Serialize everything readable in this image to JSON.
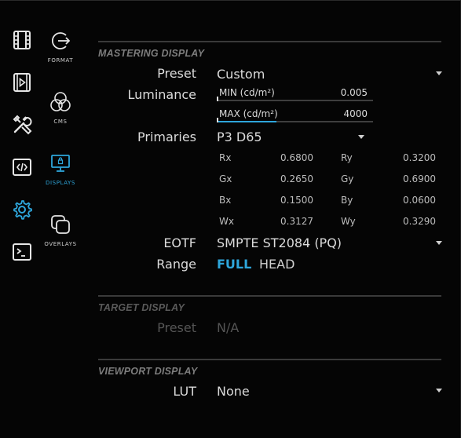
{
  "rail": [
    {
      "name": "film-icon"
    },
    {
      "name": "play-frame-icon"
    },
    {
      "name": "tools-icon"
    },
    {
      "name": "code-icon"
    },
    {
      "name": "settings-gear-icon"
    },
    {
      "name": "terminal-icon"
    }
  ],
  "submenu": {
    "format": "FORMAT",
    "cms": "CMS",
    "displays": "DISPLAYS",
    "overlays": "OVERLAYS"
  },
  "mastering": {
    "title": "MASTERING DISPLAY",
    "preset_label": "Preset",
    "preset_value": "Custom",
    "luminance_label": "Luminance",
    "min_label": "MIN (cd/m²)",
    "min_value": "0.005",
    "max_label": "MAX (cd/m²)",
    "max_value": "4000",
    "max_fill": 0.38,
    "primaries_label": "Primaries",
    "primaries_value": "P3 D65",
    "coords": {
      "rx_label": "Rx",
      "rx": "0.6800",
      "ry_label": "Ry",
      "ry": "0.3200",
      "gx_label": "Gx",
      "gx": "0.2650",
      "gy_label": "Gy",
      "gy": "0.6900",
      "bx_label": "Bx",
      "bx": "0.1500",
      "by_label": "By",
      "by": "0.0600",
      "wx_label": "Wx",
      "wx": "0.3127",
      "wy_label": "Wy",
      "wy": "0.3290"
    },
    "eotf_label": "EOTF",
    "eotf_value": "SMPTE ST2084 (PQ)",
    "range_label": "Range",
    "range_full": "FULL",
    "range_head": "HEAD"
  },
  "target": {
    "title": "TARGET DISPLAY",
    "preset_label": "Preset",
    "preset_value": "N/A"
  },
  "viewport": {
    "title": "VIEWPORT DISPLAY",
    "lut_label": "LUT",
    "lut_value": "None"
  },
  "colors": {
    "accent": "#2ea6db",
    "text": "#dcdcdc",
    "dim": "#555555"
  }
}
